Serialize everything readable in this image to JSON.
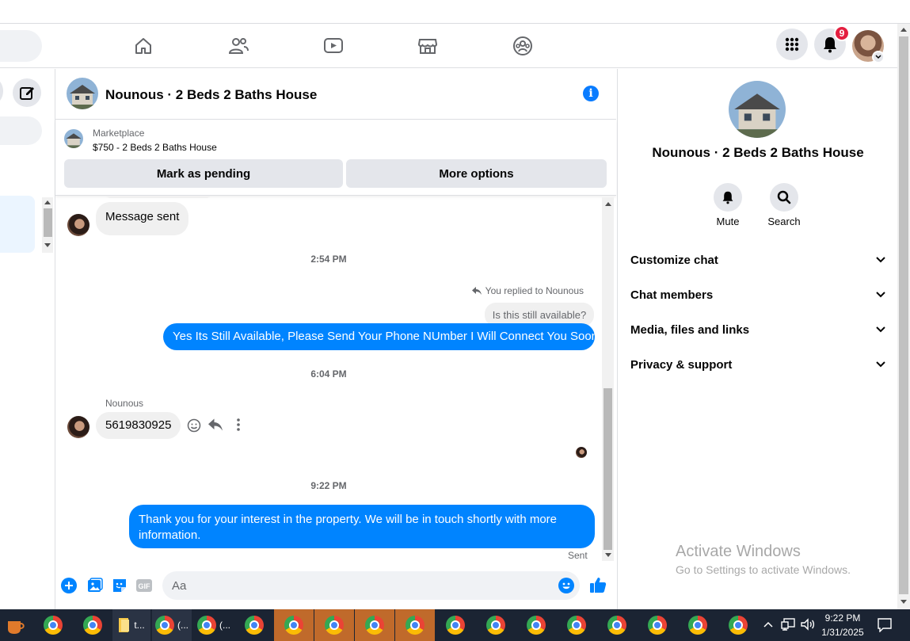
{
  "header": {
    "notification_count": "9"
  },
  "conversation": {
    "title": "Nounous · 2 Beds 2 Baths House",
    "marketplace_label": "Marketplace",
    "listing": "$750 - 2 Beds 2 Baths House",
    "mark_pending_label": "Mark as pending",
    "more_options_label": "More options"
  },
  "messages": {
    "msg1": "Message sent",
    "ts1": "2:54 PM",
    "reply_context": "You replied to Nounous",
    "quoted": "Is this still available?",
    "msg2": "Yes Its Still Available, Please Send Your Phone NUmber I Will Connect You Soon",
    "ts2": "6:04 PM",
    "sender_name": "Nounous",
    "msg3": "5619830925",
    "ts3": "9:22 PM",
    "msg4": "Thank you for your interest in the property. We will be in touch shortly with more information.",
    "status": "Sent"
  },
  "composer": {
    "placeholder": "Aa"
  },
  "right_panel": {
    "title": "Nounous · 2 Beds 2 Baths House",
    "mute_label": "Mute",
    "search_label": "Search",
    "sections": [
      "Customize chat",
      "Chat members",
      "Media, files and links",
      "Privacy & support"
    ]
  },
  "watermark": {
    "title": "Activate Windows",
    "subtitle": "Go to Settings to activate Windows."
  },
  "taskbar": {
    "item_labels": [
      "t...",
      "(...",
      "(..."
    ],
    "time": "9:22 PM",
    "date": "1/31/2025"
  },
  "colors": {
    "accent": "#0084ff",
    "badge": "#e41e3f",
    "taskbar": "#1b2433"
  }
}
